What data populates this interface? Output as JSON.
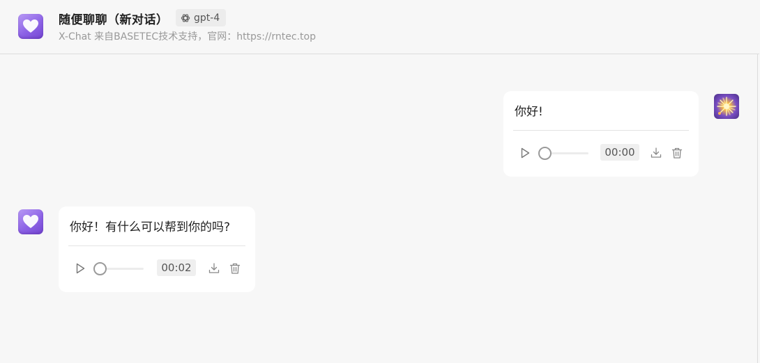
{
  "header": {
    "title": "随便聊聊（新对话）",
    "model": "gpt-4",
    "subtitle": "X-Chat 来自BASETEC技术支持，官网：https://rntec.top",
    "app_icon": "heart-icon",
    "model_icon": "openai-icon"
  },
  "messages": [
    {
      "role": "user",
      "text": "你好!",
      "audio": {
        "time": "00:00",
        "progress": 0
      },
      "avatar_icon": "sparkle-icon"
    },
    {
      "role": "assistant",
      "text": "你好！有什么可以帮到你的吗?",
      "audio": {
        "time": "00:02",
        "progress": 0
      },
      "avatar_icon": "heart-icon"
    }
  ],
  "icons": {
    "play": "play-icon",
    "download": "download-icon",
    "delete": "trash-icon"
  },
  "colors": {
    "background": "#f7f7f7",
    "bubble": "#ffffff",
    "accent": "#8d63e6",
    "muted_text": "#999999"
  }
}
